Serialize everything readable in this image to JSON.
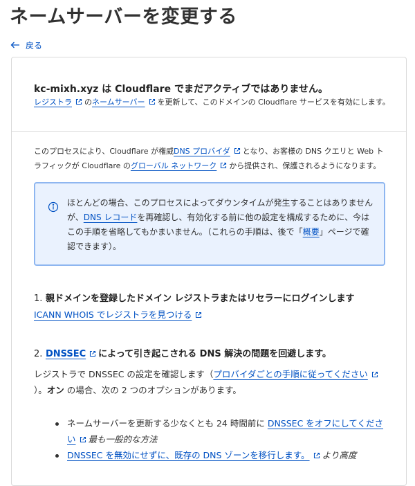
{
  "page": {
    "title": "ネームサーバーを変更する",
    "back_label": "戻る"
  },
  "card": {
    "status_heading": "kc-mixh.xyz は Cloudflare でまだアクティブではありません。",
    "status_sub": {
      "registrar_link": "レジストラ",
      "part1": "の",
      "nameserver_link": "ネームサーバー",
      "part2": "を更新して、このドメインの Cloudflare サービスを有効にします。"
    },
    "intro": {
      "part1": "このプロセスにより、Cloudflare が権威",
      "dns_provider_link": "DNS プロバイダ",
      "part2": "となり、お客様の DNS クエリと Web トラフィックが Cloudflare の",
      "global_network_link": "グローバル ネットワーク",
      "part3": "から提供され、保護されるようになります。"
    },
    "info": {
      "part1": "ほとんどの場合、このプロセスによってダウンタイムが発生することはありませんが、",
      "dns_records_link": "DNS レコード",
      "part2": "を再確認し、有効化する前に他の設定を構成するために、今はこの手順を省略してもかまいません。（これらの手順は、後で「",
      "overview_link": "概要",
      "part3": "」ページで確認できます）。"
    },
    "step1": {
      "number": "1.",
      "title": "親ドメインを登録したドメイン レジストラまたはリセラーにログインします",
      "link": "ICANN WHOIS でレジストラを見つける"
    },
    "step2": {
      "number": "2.",
      "title_link": "DNSSEC",
      "title_rest": "によって引き起こされる DNS 解決の問題を回避します。",
      "text_part1": "レジストラで DNSSEC の設定を確認します（",
      "provider_steps_link": "プロバイダごとの手順に従ってください",
      "text_part2": "）。",
      "text_bold": "オン",
      "text_part3": " の場合、次の 2 つのオプションがあります。",
      "options": [
        {
          "pre": "ネームサーバーを更新する少なくとも 24 時間前に ",
          "link": "DNSSEC をオフにしてください",
          "note": "最も一般的な方法"
        },
        {
          "pre": "",
          "link": "DNSSEC を無効にせずに、既存の DNS ゾーンを移行します。",
          "note": "より高度"
        }
      ]
    }
  },
  "colors": {
    "link": "#0051c3",
    "text": "#313131",
    "callout_bg": "#eaf2fe",
    "callout_border": "#8eb6f0",
    "border": "#d9d9d9"
  },
  "icons": {
    "back": "arrow-left-icon",
    "external": "external-link-icon",
    "info": "info-circle-icon"
  }
}
